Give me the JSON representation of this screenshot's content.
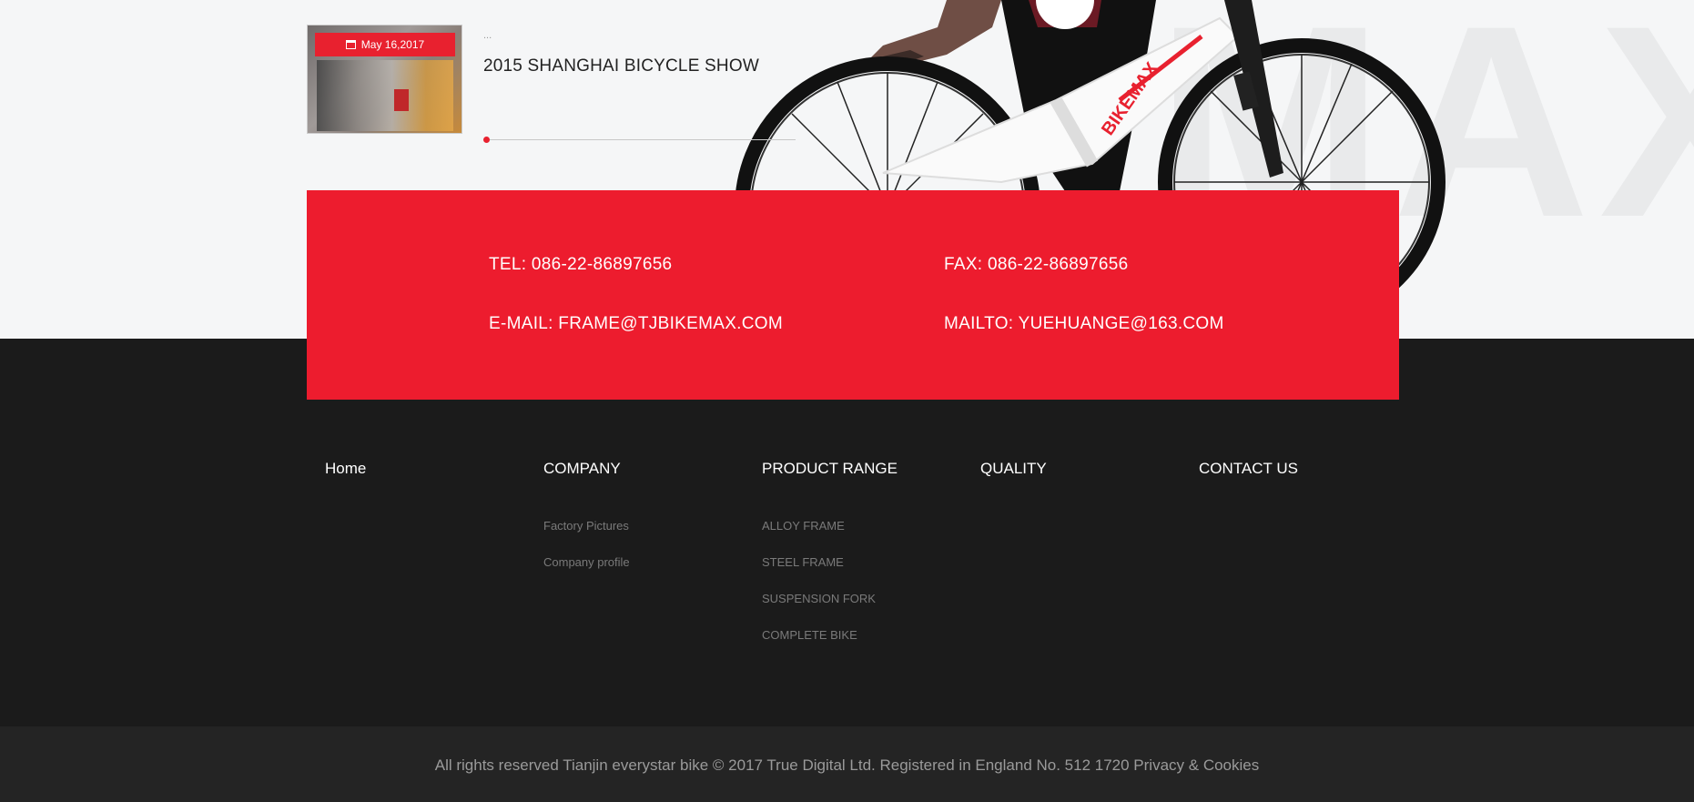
{
  "news": {
    "date": "May 16,2017",
    "dots": "...",
    "title": "2015 SHANGHAI BICYCLE SHOW"
  },
  "hero": {
    "watermark": "MAX",
    "frame_brand": "BIKEMAX"
  },
  "contact": {
    "tel": "TEL: 086-22-86897656",
    "fax": "FAX: 086-22-86897656",
    "email": "E-MAIL: FRAME@TJBIKEMAX.COM",
    "mailto": "MAILTO: YUEHUANGE@163.COM"
  },
  "footer": {
    "columns": [
      {
        "heading": "Home",
        "links": []
      },
      {
        "heading": "COMPANY",
        "links": [
          "Factory Pictures",
          "Company profile"
        ]
      },
      {
        "heading": "PRODUCT RANGE",
        "links": [
          "ALLOY FRAME",
          "STEEL FRAME",
          "SUSPENSION FORK",
          "COMPLETE BIKE"
        ]
      },
      {
        "heading": "QUALITY",
        "links": []
      },
      {
        "heading": "CONTACT US",
        "links": []
      }
    ],
    "copyright": "All rights reserved Tianjin everystar bike © 2017 True Digital Ltd. Registered in England No. 512 1720 Privacy & Cookies"
  },
  "colors": {
    "accent": "#ed1c2e",
    "footer_bg": "#1b1b1b",
    "copyright_bg": "#242424",
    "page_bg": "#f5f6f7"
  }
}
